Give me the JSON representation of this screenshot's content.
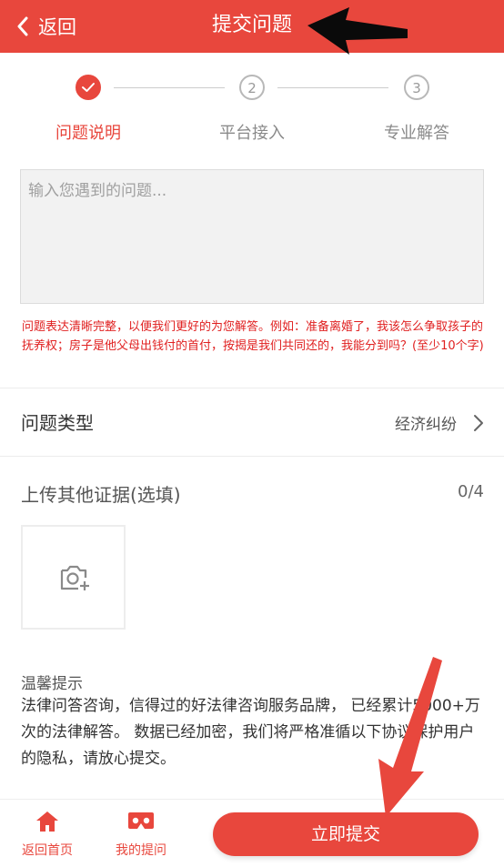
{
  "header": {
    "back_label": "返回",
    "title": "提交问题",
    "background": "#e8473d"
  },
  "steps": [
    {
      "number": "",
      "label": "问题说明",
      "state": "active"
    },
    {
      "number": "2",
      "label": "平台接入",
      "state": "inactive"
    },
    {
      "number": "3",
      "label": "专业解答",
      "state": "inactive"
    }
  ],
  "question": {
    "placeholder": "输入您遇到的问题...",
    "value": "",
    "hint": "问题表达清晰完整，以便我们更好的为您解答。例如：准备离婚了，我该怎么争取孩子的抚养权；房子是他父母出钱付的首付，按揭是我们共同还的，我能分到吗？(至少10个字)"
  },
  "question_type": {
    "label": "问题类型",
    "value": "经济纠纷"
  },
  "upload": {
    "title": "上传其他证据(选填)",
    "count": "0/4",
    "icon": "camera-add-icon"
  },
  "tips": {
    "title": "温馨提示",
    "body": "法律问答咨询，信得过的好法律咨询服务品牌， 已经累计5000+万次的法律解答。 数据已经加密，我们将严格准循以下协议保护用户的隐私，请放心提交。"
  },
  "bottom_nav": {
    "home_label": "返回首页",
    "home_icon": "home-icon",
    "questions_label": "我的提问",
    "questions_icon": "vr-glasses-icon",
    "submit_label": "立即提交"
  },
  "colors": {
    "accent": "#e8473d",
    "hint_red": "#e02020"
  }
}
